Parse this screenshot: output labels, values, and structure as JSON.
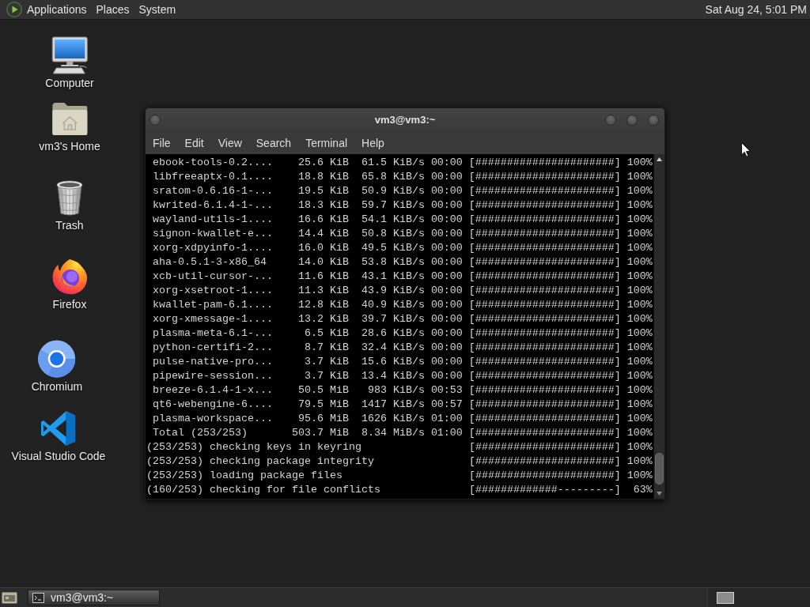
{
  "top_panel": {
    "menus": [
      "Applications",
      "Places",
      "System"
    ],
    "clock": "Sat Aug 24, 5:01 PM"
  },
  "desktop_icons": [
    {
      "label": "Computer",
      "kind": "computer"
    },
    {
      "label": "vm3's Home",
      "kind": "home"
    },
    {
      "label": "Trash",
      "kind": "trash"
    },
    {
      "label": "Firefox",
      "kind": "firefox"
    },
    {
      "label": "Chromium",
      "kind": "chromium"
    },
    {
      "label": "Visual Studio Code",
      "kind": "vscode"
    }
  ],
  "terminal": {
    "title": "vm3@vm3:~",
    "menu": [
      "File",
      "Edit",
      "View",
      "Search",
      "Terminal",
      "Help"
    ],
    "downloads": [
      {
        "name": "ebook-tools-0.2....",
        "size": "25.6 KiB",
        "rate": "61.5 KiB/s",
        "time": "00:00",
        "bar": "[######################]",
        "percent": "100%"
      },
      {
        "name": "libfreeaptx-0.1....",
        "size": "18.8 KiB",
        "rate": "65.8 KiB/s",
        "time": "00:00",
        "bar": "[######################]",
        "percent": "100%"
      },
      {
        "name": "sratom-0.6.16-1-...",
        "size": "19.5 KiB",
        "rate": "50.9 KiB/s",
        "time": "00:00",
        "bar": "[######################]",
        "percent": "100%"
      },
      {
        "name": "kwrited-6.1.4-1-...",
        "size": "18.3 KiB",
        "rate": "59.7 KiB/s",
        "time": "00:00",
        "bar": "[######################]",
        "percent": "100%"
      },
      {
        "name": "wayland-utils-1....",
        "size": "16.6 KiB",
        "rate": "54.1 KiB/s",
        "time": "00:00",
        "bar": "[######################]",
        "percent": "100%"
      },
      {
        "name": "signon-kwallet-e...",
        "size": "14.4 KiB",
        "rate": "50.8 KiB/s",
        "time": "00:00",
        "bar": "[######################]",
        "percent": "100%"
      },
      {
        "name": "xorg-xdpyinfo-1....",
        "size": "16.0 KiB",
        "rate": "49.5 KiB/s",
        "time": "00:00",
        "bar": "[######################]",
        "percent": "100%"
      },
      {
        "name": "aha-0.5.1-3-x86_64",
        "size": "14.0 KiB",
        "rate": "53.8 KiB/s",
        "time": "00:00",
        "bar": "[######################]",
        "percent": "100%"
      },
      {
        "name": "xcb-util-cursor-...",
        "size": "11.6 KiB",
        "rate": "43.1 KiB/s",
        "time": "00:00",
        "bar": "[######################]",
        "percent": "100%"
      },
      {
        "name": "xorg-xsetroot-1....",
        "size": "11.3 KiB",
        "rate": "43.9 KiB/s",
        "time": "00:00",
        "bar": "[######################]",
        "percent": "100%"
      },
      {
        "name": "kwallet-pam-6.1....",
        "size": "12.8 KiB",
        "rate": "40.9 KiB/s",
        "time": "00:00",
        "bar": "[######################]",
        "percent": "100%"
      },
      {
        "name": "xorg-xmessage-1....",
        "size": "13.2 KiB",
        "rate": "39.7 KiB/s",
        "time": "00:00",
        "bar": "[######################]",
        "percent": "100%"
      },
      {
        "name": "plasma-meta-6.1-...",
        "size": "6.5 KiB",
        "rate": "28.6 KiB/s",
        "time": "00:00",
        "bar": "[######################]",
        "percent": "100%"
      },
      {
        "name": "python-certifi-2...",
        "size": "8.7 KiB",
        "rate": "32.4 KiB/s",
        "time": "00:00",
        "bar": "[######################]",
        "percent": "100%"
      },
      {
        "name": "pulse-native-pro...",
        "size": "3.7 KiB",
        "rate": "15.6 KiB/s",
        "time": "00:00",
        "bar": "[######################]",
        "percent": "100%"
      },
      {
        "name": "pipewire-session...",
        "size": "3.7 KiB",
        "rate": "13.4 KiB/s",
        "time": "00:00",
        "bar": "[######################]",
        "percent": "100%"
      },
      {
        "name": "breeze-6.1.4-1-x...",
        "size": "50.5 MiB",
        "rate": "983 KiB/s",
        "time": "00:53",
        "bar": "[######################]",
        "percent": "100%"
      },
      {
        "name": "qt6-webengine-6....",
        "size": "79.5 MiB",
        "rate": "1417 KiB/s",
        "time": "00:57",
        "bar": "[######################]",
        "percent": "100%"
      },
      {
        "name": "plasma-workspace...",
        "size": "95.6 MiB",
        "rate": "1626 KiB/s",
        "time": "01:00",
        "bar": "[######################]",
        "percent": "100%"
      },
      {
        "name": "Total (253/253)",
        "size": "503.7 MiB",
        "rate": "8.34 MiB/s",
        "time": "01:00",
        "bar": "[######################]",
        "percent": "100%"
      }
    ],
    "steps": [
      {
        "message": "(253/253) checking keys in keyring",
        "bar": "[######################]",
        "percent": "100%"
      },
      {
        "message": "(253/253) checking package integrity",
        "bar": "[######################]",
        "percent": "100%"
      },
      {
        "message": "(253/253) loading package files",
        "bar": "[######################]",
        "percent": "100%"
      },
      {
        "message": "(160/253) checking for file conflicts",
        "bar": "[#############---------]",
        "percent": "63%"
      }
    ]
  },
  "taskbar": {
    "tasks": [
      "vm3@vm3:~"
    ]
  }
}
